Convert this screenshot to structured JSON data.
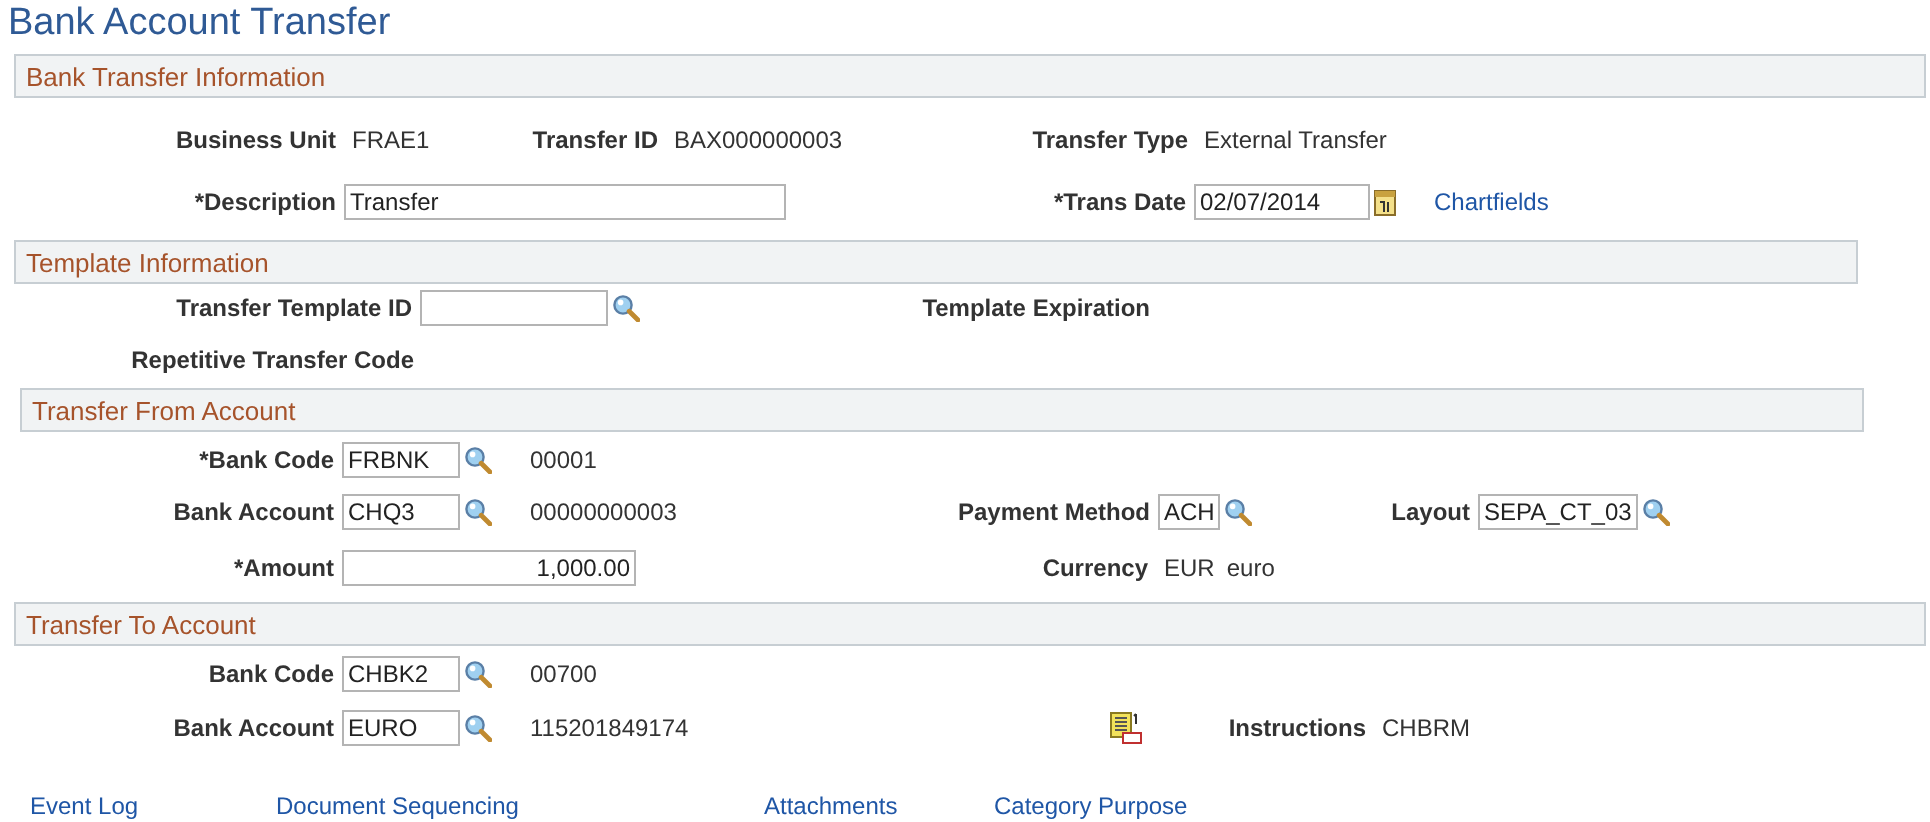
{
  "title": "Bank Account Transfer",
  "sections": [
    {
      "title": "Bank Transfer Information",
      "rows": [
        {
          "fields": [
            {
              "kind": "text",
              "label": "Business Unit",
              "value": "FRAE1"
            },
            {
              "kind": "text",
              "label": "Transfer ID",
              "value": "BAX000000003"
            },
            {
              "kind": "text",
              "label": "Transfer Type",
              "value": "External Transfer"
            }
          ]
        },
        {
          "fields": [
            {
              "kind": "input",
              "label": "*Description",
              "value": "Transfer"
            },
            {
              "kind": "date",
              "label": "*Trans Date",
              "value": "02/07/2014",
              "link": "Chartfields"
            }
          ]
        }
      ]
    },
    {
      "title": "Template Information",
      "rows": [
        {
          "fields": [
            {
              "kind": "lookup",
              "label": "Transfer Template ID"
            },
            {
              "kind": "label",
              "label": "Template Expiration"
            }
          ]
        },
        {
          "fields": [
            {
              "kind": "label",
              "label": "Repetitive Transfer Code"
            }
          ]
        }
      ]
    },
    {
      "title": "Transfer From Account",
      "rows": [
        {
          "fields": [
            {
              "kind": "lookup",
              "label": "*Bank Code",
              "value": "FRBNK",
              "description": "00001"
            }
          ]
        },
        {
          "fields": [
            {
              "kind": "lookup",
              "label": "Bank Account",
              "value": "CHQ3",
              "description": "00000000003"
            },
            {
              "kind": "lookup",
              "label": "Payment Method",
              "value": "ACH"
            },
            {
              "kind": "lookup",
              "label": "Layout",
              "value": "SEPA_CT_03"
            }
          ]
        },
        {
          "fields": [
            {
              "kind": "amount",
              "label": "*Amount",
              "value": "1,000.00"
            },
            {
              "kind": "currency",
              "label": "Currency",
              "code": "EUR",
              "name": "euro"
            }
          ]
        }
      ]
    },
    {
      "title": "Transfer To Account",
      "rows": [
        {
          "fields": [
            {
              "kind": "lookup",
              "label": "Bank Code",
              "value": "CHBK2",
              "description": "00700"
            }
          ]
        },
        {
          "fields": [
            {
              "kind": "lookup",
              "label": "Bank Account",
              "value": "EURO",
              "description": "115201849174"
            },
            {
              "kind": "instructions",
              "label": "Instructions",
              "value": "CHBRM"
            }
          ]
        }
      ]
    }
  ],
  "links": [
    "Event Log",
    "Document Sequencing",
    "Attachments",
    "Category Purpose"
  ]
}
